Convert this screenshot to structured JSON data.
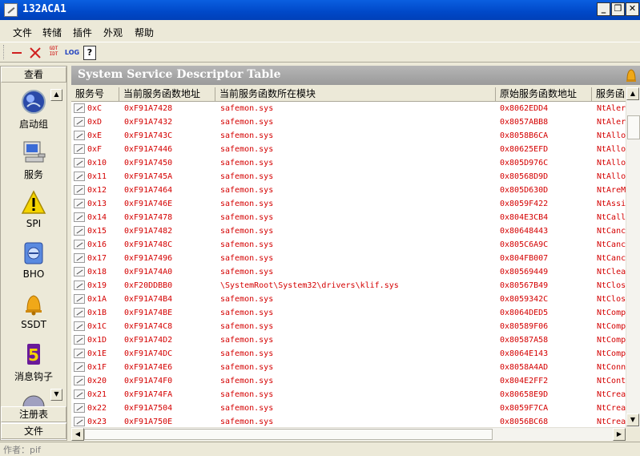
{
  "window": {
    "title": "132ACA1"
  },
  "menu": [
    "文件",
    "转储",
    "插件",
    "外观",
    "帮助"
  ],
  "toolbar": {
    "gdt_label": "GDT\nIDT",
    "log_label": "LOG",
    "help_label": "?"
  },
  "left_panel": {
    "top_tab": "查看",
    "items": [
      {
        "label": "启动组",
        "icon": "startup-globe-icon"
      },
      {
        "label": "服务",
        "icon": "computer-icon"
      },
      {
        "label": "SPI",
        "icon": "warning-icon"
      },
      {
        "label": "BHO",
        "icon": "bho-icon"
      },
      {
        "label": "SSDT",
        "icon": "bell-icon"
      },
      {
        "label": "消息钩子",
        "icon": "hook-five-icon"
      }
    ],
    "bottom_tabs": [
      "注册表",
      "文件"
    ]
  },
  "main": {
    "title": "System Service Descriptor Table"
  },
  "table": {
    "columns": [
      "服务号",
      "当前服务函数地址",
      "当前服务函数所在模块",
      "原始服务函数地址",
      "服务函"
    ],
    "rows": [
      [
        "0xC",
        "0xF91A7428",
        "safemon.sys",
        "0x8062EDD4",
        "NtAler"
      ],
      [
        "0xD",
        "0xF91A7432",
        "safemon.sys",
        "0x8057ABB8",
        "NtAler"
      ],
      [
        "0xE",
        "0xF91A743C",
        "safemon.sys",
        "0x8058B6CA",
        "NtAllo"
      ],
      [
        "0xF",
        "0xF91A7446",
        "safemon.sys",
        "0x80625EFD",
        "NtAllo"
      ],
      [
        "0x10",
        "0xF91A7450",
        "safemon.sys",
        "0x805D976C",
        "NtAllo"
      ],
      [
        "0x11",
        "0xF91A745A",
        "safemon.sys",
        "0x80568D9D",
        "NtAllo"
      ],
      [
        "0x12",
        "0xF91A7464",
        "safemon.sys",
        "0x805D630D",
        "NtAreM"
      ],
      [
        "0x13",
        "0xF91A746E",
        "safemon.sys",
        "0x8059F422",
        "NtAssi"
      ],
      [
        "0x14",
        "0xF91A7478",
        "safemon.sys",
        "0x804E3CB4",
        "NtCall"
      ],
      [
        "0x15",
        "0xF91A7482",
        "safemon.sys",
        "0x80648443",
        "NtCanc"
      ],
      [
        "0x16",
        "0xF91A748C",
        "safemon.sys",
        "0x805C6A9C",
        "NtCanc"
      ],
      [
        "0x17",
        "0xF91A7496",
        "safemon.sys",
        "0x804FB007",
        "NtCanc"
      ],
      [
        "0x18",
        "0xF91A74A0",
        "safemon.sys",
        "0x80569449",
        "NtClea"
      ],
      [
        "0x19",
        "0xF20DDBB0",
        "\\SystemRoot\\System32\\drivers\\klif.sys",
        "0x80567B49",
        "NtClos"
      ],
      [
        "0x1A",
        "0xF91A74B4",
        "safemon.sys",
        "0x8059342C",
        "NtClos"
      ],
      [
        "0x1B",
        "0xF91A74BE",
        "safemon.sys",
        "0x8064DED5",
        "NtComp"
      ],
      [
        "0x1C",
        "0xF91A74C8",
        "safemon.sys",
        "0x80589F06",
        "NtComp"
      ],
      [
        "0x1D",
        "0xF91A74D2",
        "safemon.sys",
        "0x80587A58",
        "NtComp"
      ],
      [
        "0x1E",
        "0xF91A74DC",
        "safemon.sys",
        "0x8064E143",
        "NtComp"
      ],
      [
        "0x1F",
        "0xF91A74E6",
        "safemon.sys",
        "0x8058A4AD",
        "NtConn"
      ],
      [
        "0x20",
        "0xF91A74F0",
        "safemon.sys",
        "0x804E2FF2",
        "NtCont"
      ],
      [
        "0x21",
        "0xF91A74FA",
        "safemon.sys",
        "0x80658E9D",
        "NtCrea"
      ],
      [
        "0x22",
        "0xF91A7504",
        "safemon.sys",
        "0x8059F7CA",
        "NtCrea"
      ],
      [
        "0x23",
        "0xF91A750E",
        "safemon.sys",
        "0x8056BC68",
        "NtCrea"
      ]
    ]
  },
  "status": {
    "text": "作者：pif"
  }
}
